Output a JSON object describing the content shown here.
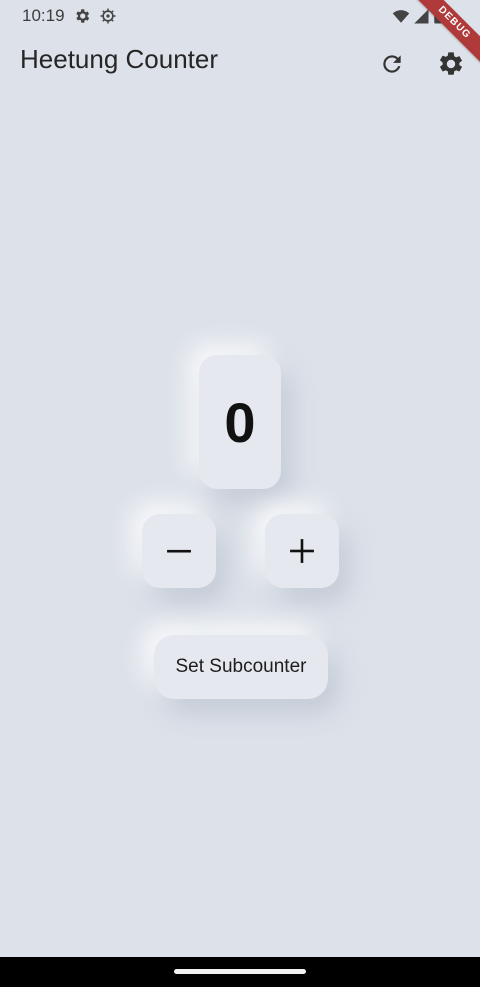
{
  "status_bar": {
    "time": "10:19",
    "icons": [
      "settings-gear-icon",
      "bug-icon",
      "wifi-icon",
      "signal-icon",
      "battery-icon"
    ]
  },
  "debug_banner": "DEBUG",
  "app_bar": {
    "title": "Heetung Counter",
    "actions": [
      "refresh-icon",
      "settings-icon"
    ]
  },
  "counter": {
    "value": "0",
    "decrement_label": "−",
    "increment_label": "+"
  },
  "subcounter_button": {
    "label": "Set Subcounter"
  },
  "colors": {
    "background": "#dde2ea",
    "surface": "#e5e8ee",
    "debug_ribbon": "#b03a3a"
  }
}
